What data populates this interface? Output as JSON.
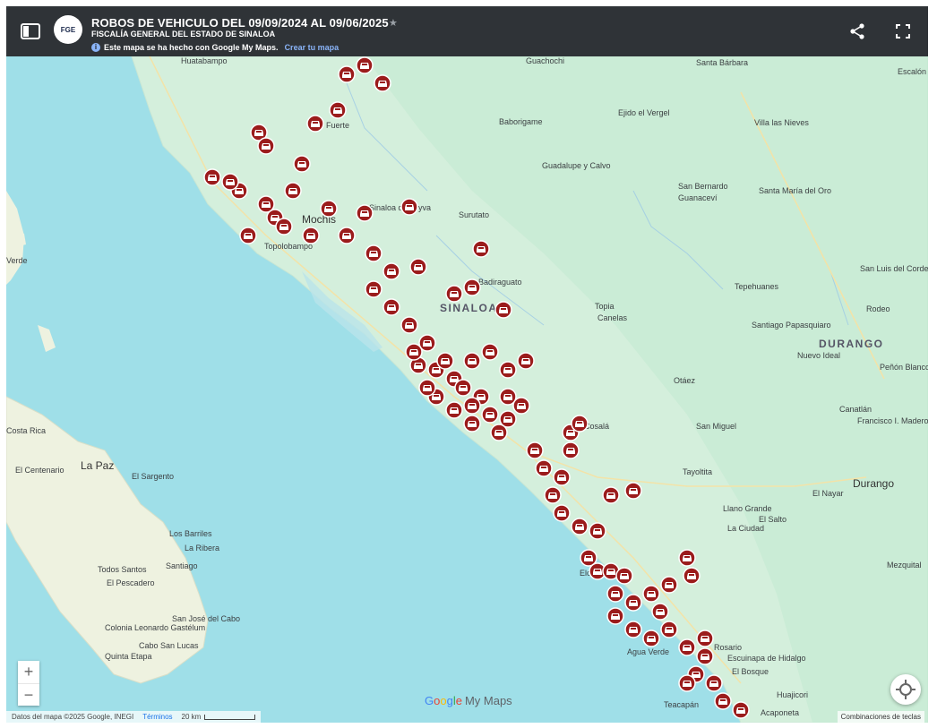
{
  "header": {
    "title": "ROBOS DE VEHICULO DEL 09/09/2024 AL 09/06/2025",
    "subtitle": "FISCALÍA GENERAL DEL ESTADO DE SINALOA",
    "logo_text": "FGE",
    "notice_text": "Este mapa se ha hecho con Google My Maps.",
    "notice_link": "Crear tu mapa"
  },
  "icons": {
    "sidebar": "sidebar-toggle-icon",
    "share": "share-icon",
    "fullscreen": "fullscreen-icon",
    "star": "star-icon",
    "marker": "car-icon",
    "locate": "my-location-icon"
  },
  "map": {
    "places": [
      "Huatabampo",
      "Guachochi",
      "Santa Bárbara",
      "Escalón",
      "Baborigame",
      "Ejido el Vergel",
      "Villa las Nieves",
      "Guadalupe y Calvo",
      "San Bernardo",
      "Guanaceví",
      "Santa María del Oro",
      "Surutato",
      "Mochis",
      "Topolobampo",
      "Sinaloa de Leyva",
      "Badiraguato",
      "SINALOA",
      "Topia",
      "Canelas",
      "Tepehuanes",
      "San Luis del Cordero",
      "Rodeo",
      "Santiago Papasquiaro",
      "DURANGO",
      "Nuevo Ideal",
      "Peñón Blanco",
      "Otáez",
      "Canatlán",
      "Francisco I. Madero",
      "San Miguel",
      "Cosalá",
      "Tayoltita",
      "Durango",
      "El Nayar",
      "Llano Grande",
      "El Salto",
      "La Ciudad",
      "El Centenario",
      "La Paz",
      "El Sargento",
      "Los Barriles",
      "La Ribera",
      "Todos Santos",
      "Santiago",
      "El Pescadero",
      "Colonia Leonardo Gastélum",
      "Quinta Etapa",
      "San José del Cabo",
      "Cabo San Lucas",
      "Mezquital",
      "Huajicori",
      "Acaponeta",
      "Teacapán",
      "Elota",
      "Agua Verde",
      "Rosario",
      "Escuinapa de Hidalgo",
      "El Bosque",
      "Verde",
      "Costa Rica",
      "Fuerte"
    ],
    "marker_color": "#9b1c1c",
    "water_color": "#9fdfe8",
    "land_color": "#d6f0df"
  },
  "controls": {
    "zoom_in": "+",
    "zoom_out": "−"
  },
  "footer": {
    "attribution": "Datos del mapa ©2025 Google, INEGI",
    "terms": "Términos",
    "scale": "20 km",
    "shortcuts": "Combinaciones de teclas"
  },
  "branding": {
    "google": [
      "G",
      "o",
      "o",
      "g",
      "l",
      "e"
    ],
    "my_maps": "My Maps"
  }
}
